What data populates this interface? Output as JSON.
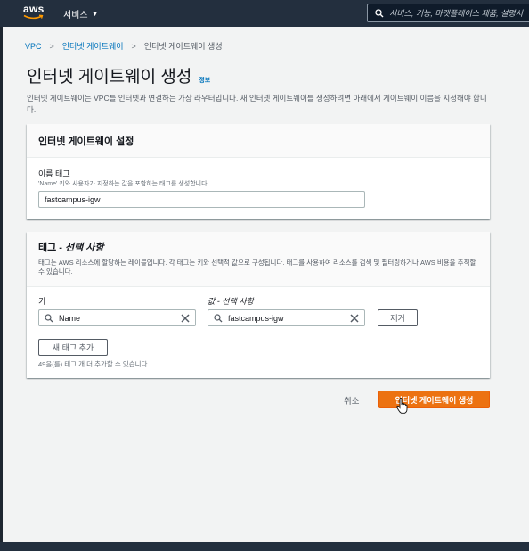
{
  "topnav": {
    "logo_text": "aws",
    "services_label": "서비스",
    "search_placeholder": "서비스, 기능, 마켓플레이스 제품, 설명서"
  },
  "breadcrumb": {
    "items": [
      "VPC",
      "인터넷 게이트웨이",
      "인터넷 게이트웨이 생성"
    ]
  },
  "page": {
    "title": "인터넷 게이트웨이 생성",
    "info_link": "정보",
    "description": "인터넷 게이트웨이는 VPC를 인터넷과 연결하는 가상 라우터입니다. 새 인터넷 게이트웨이를 생성하려면 아래에서 게이트웨이 이름을 지정해야 합니다."
  },
  "settings_panel": {
    "title": "인터넷 게이트웨이 설정",
    "name_label": "이름 태그",
    "name_desc": "'Name' 키와 사용자가 지정하는 값을 포함하는 태그를 생성합니다.",
    "name_value": "fastcampus-igw"
  },
  "tags_panel": {
    "title_prefix": "태그 - ",
    "title_optional": "선택 사항",
    "description": "태그는 AWS 리소스에 할당하는 레이블입니다. 각 태그는 키와 선택적 값으로 구성됩니다. 태그를 사용하여 리소스를 검색 및 필터링하거나 AWS 비용을 추적할 수 있습니다.",
    "key_label": "키",
    "value_label": "값 - 선택 사항",
    "key_value": "Name",
    "value_value": "fastcampus-igw",
    "remove_label": "제거",
    "add_tag_label": "새 태그 추가",
    "remaining_text": "49을(를) 태그 개 더 추가할 수 있습니다."
  },
  "footer": {
    "cancel_label": "취소",
    "submit_label": "인터넷 게이트웨이 생성"
  },
  "colors": {
    "topbar": "#232f3e",
    "link": "#0073bb",
    "primary": "#ec7211",
    "page_bg": "#f2f3f3"
  }
}
